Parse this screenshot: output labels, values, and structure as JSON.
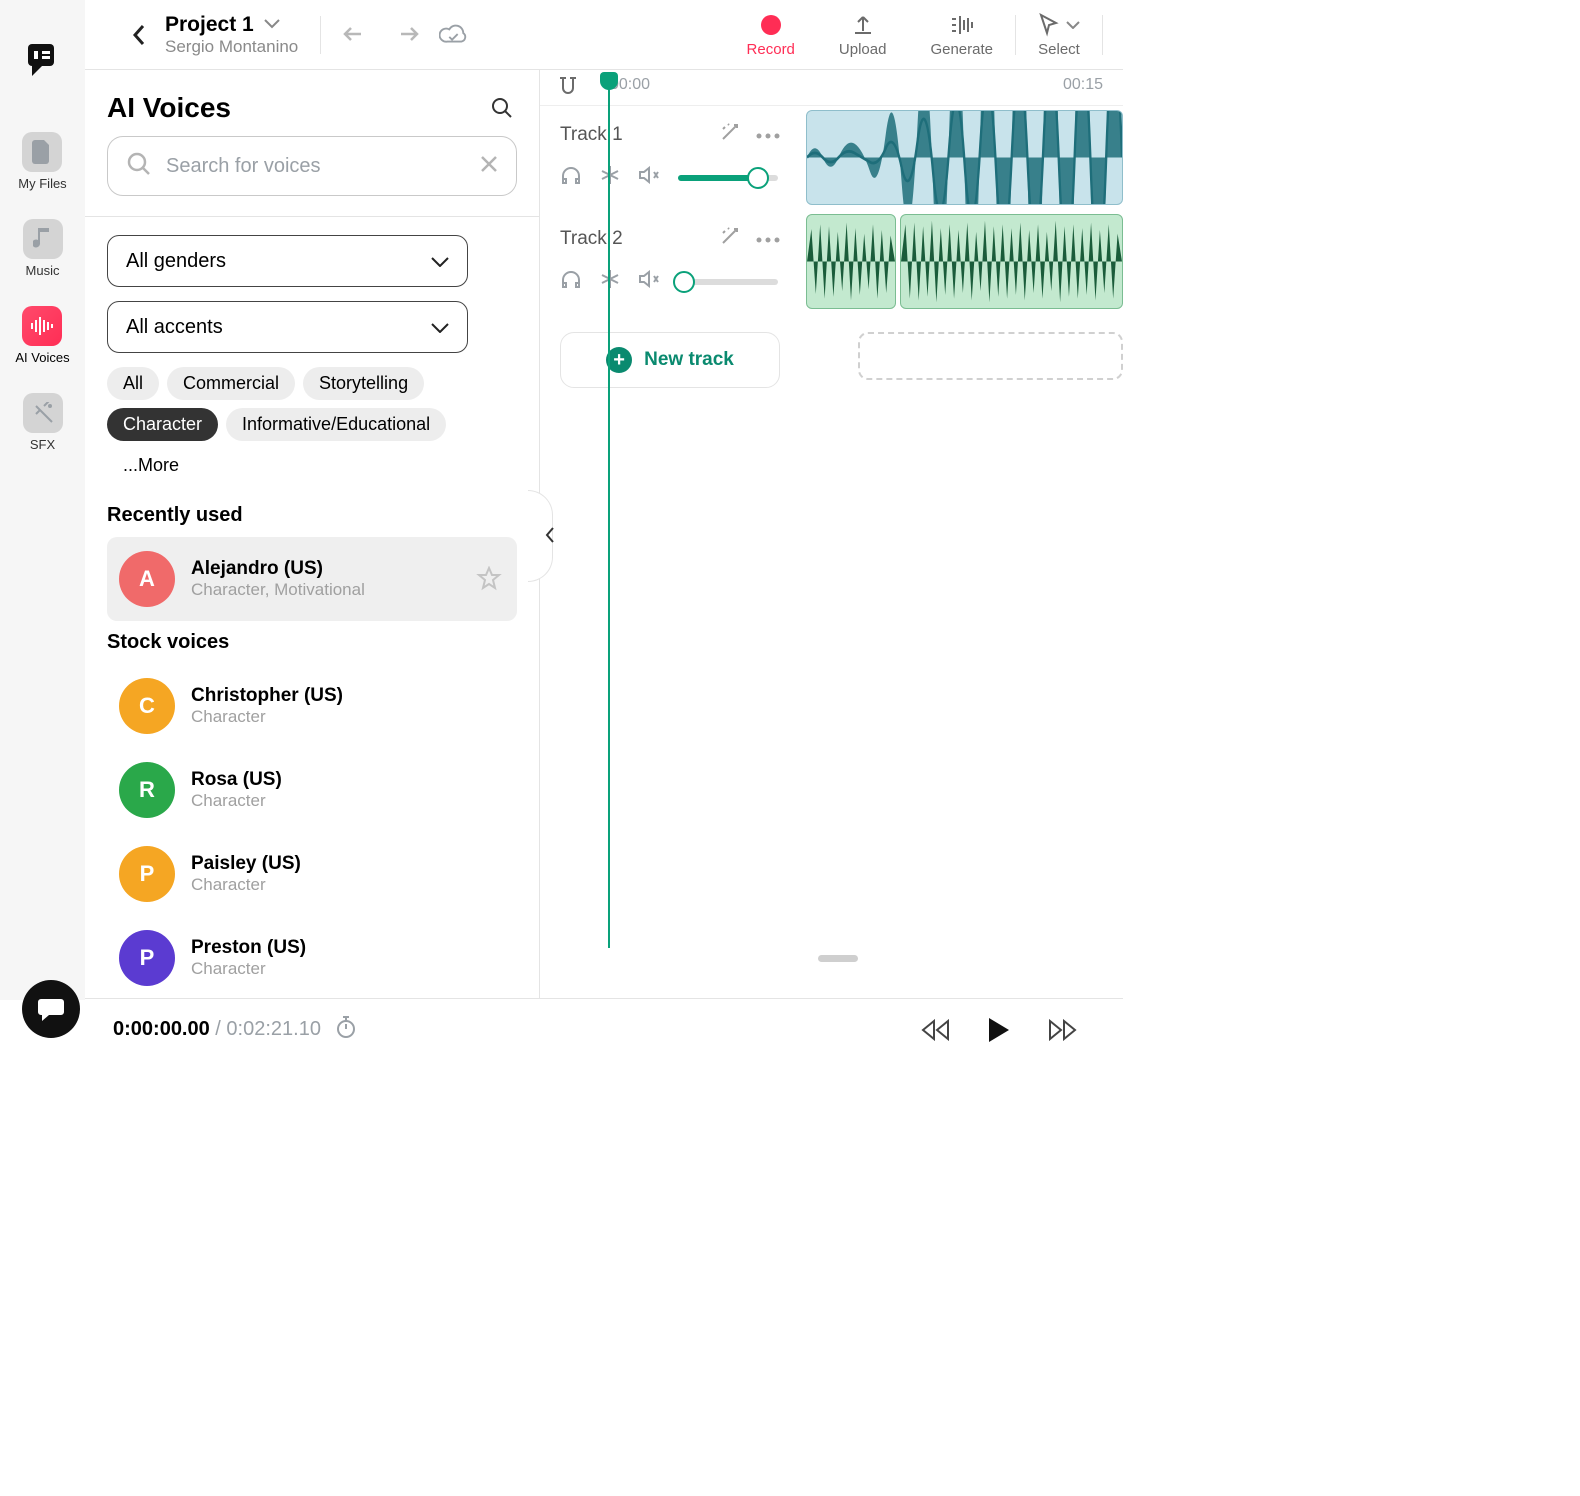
{
  "nav": {
    "items": [
      {
        "label": "My Files"
      },
      {
        "label": "Music"
      },
      {
        "label": "AI Voices"
      },
      {
        "label": "SFX"
      }
    ]
  },
  "header": {
    "project_title": "Project 1",
    "user_name": "Sergio Montanino",
    "actions": {
      "record": "Record",
      "upload": "Upload",
      "generate": "Generate",
      "select": "Select"
    }
  },
  "voices": {
    "title": "AI Voices",
    "search_placeholder": "Search for voices",
    "select_gender": "All genders",
    "select_accent": "All accents",
    "chips": [
      "All",
      "Commercial",
      "Storytelling",
      "Character",
      "Informative/Educational"
    ],
    "chips_more": "...More",
    "chip_selected_index": 3,
    "recent_label": "Recently used",
    "stock_label": "Stock voices",
    "recent": [
      {
        "initial": "A",
        "name": "Alejandro (US)",
        "tags": "Character, Motivational",
        "color": "#f06a6a"
      }
    ],
    "stock": [
      {
        "initial": "C",
        "name": "Christopher (US)",
        "tags": "Character",
        "color": "#f5a623"
      },
      {
        "initial": "R",
        "name": "Rosa (US)",
        "tags": "Character",
        "color": "#2aa84a"
      },
      {
        "initial": "P",
        "name": "Paisley (US)",
        "tags": "Character",
        "color": "#f5a623"
      },
      {
        "initial": "P",
        "name": "Preston (US)",
        "tags": "Character",
        "color": "#5b3bd1"
      }
    ]
  },
  "tracks": {
    "time_marks": {
      "t0": "00:00",
      "t15": "00:15"
    },
    "items": [
      {
        "name": "Track 1",
        "volume_pct": 80
      },
      {
        "name": "Track 2",
        "volume_pct": 6
      }
    ],
    "new_track_label": "New track"
  },
  "transport": {
    "current": "0:00:00.00",
    "separator": " / ",
    "duration": "0:02:21.10"
  }
}
